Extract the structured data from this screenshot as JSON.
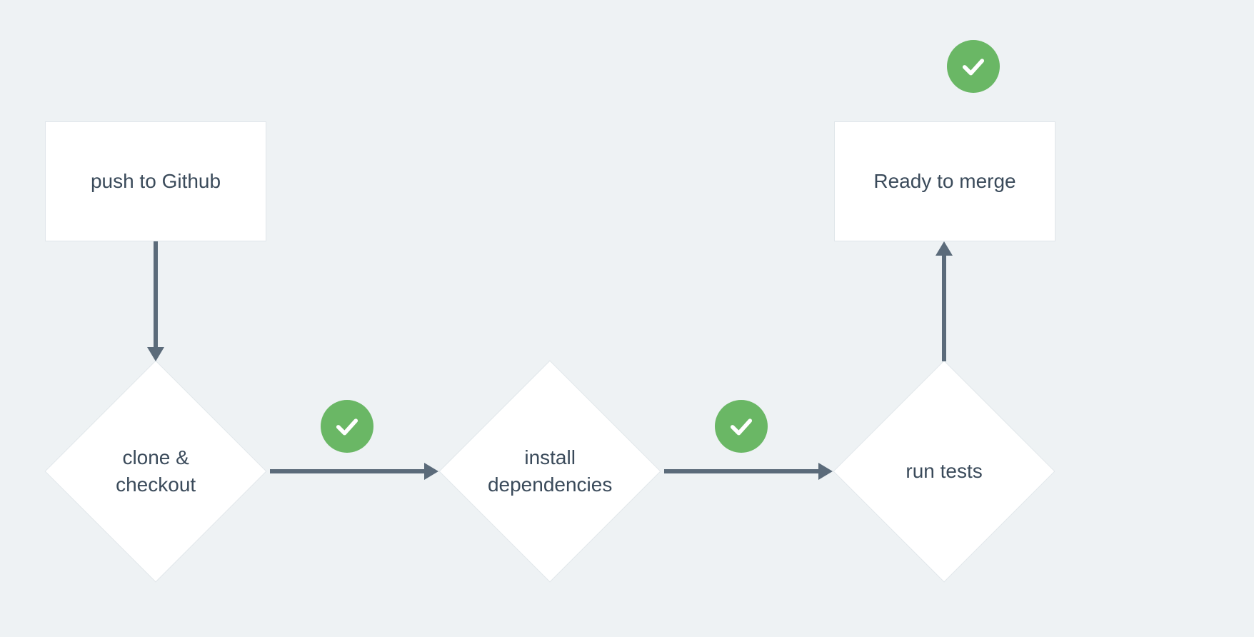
{
  "colors": {
    "bg": "#eef2f4",
    "nodeBg": "#ffffff",
    "nodeBorder": "#e0e6ea",
    "text": "#3a4a5a",
    "arrow": "#5b6b7a",
    "success": "#6ab765",
    "checkStroke": "#ffffff"
  },
  "nodes": {
    "push": {
      "label": "push to Github",
      "shape": "rect"
    },
    "clone": {
      "label": "clone & checkout",
      "shape": "diamond"
    },
    "deps": {
      "label": "install dependencies",
      "shape": "diamond"
    },
    "tests": {
      "label": "run tests",
      "shape": "diamond"
    },
    "ready": {
      "label": "Ready to merge",
      "shape": "rect"
    }
  },
  "edges": [
    {
      "from": "push",
      "to": "clone",
      "status": null
    },
    {
      "from": "clone",
      "to": "deps",
      "status": "success"
    },
    {
      "from": "deps",
      "to": "tests",
      "status": "success"
    },
    {
      "from": "tests",
      "to": "ready",
      "status": "success"
    }
  ],
  "icons": {
    "success": "check-icon"
  }
}
